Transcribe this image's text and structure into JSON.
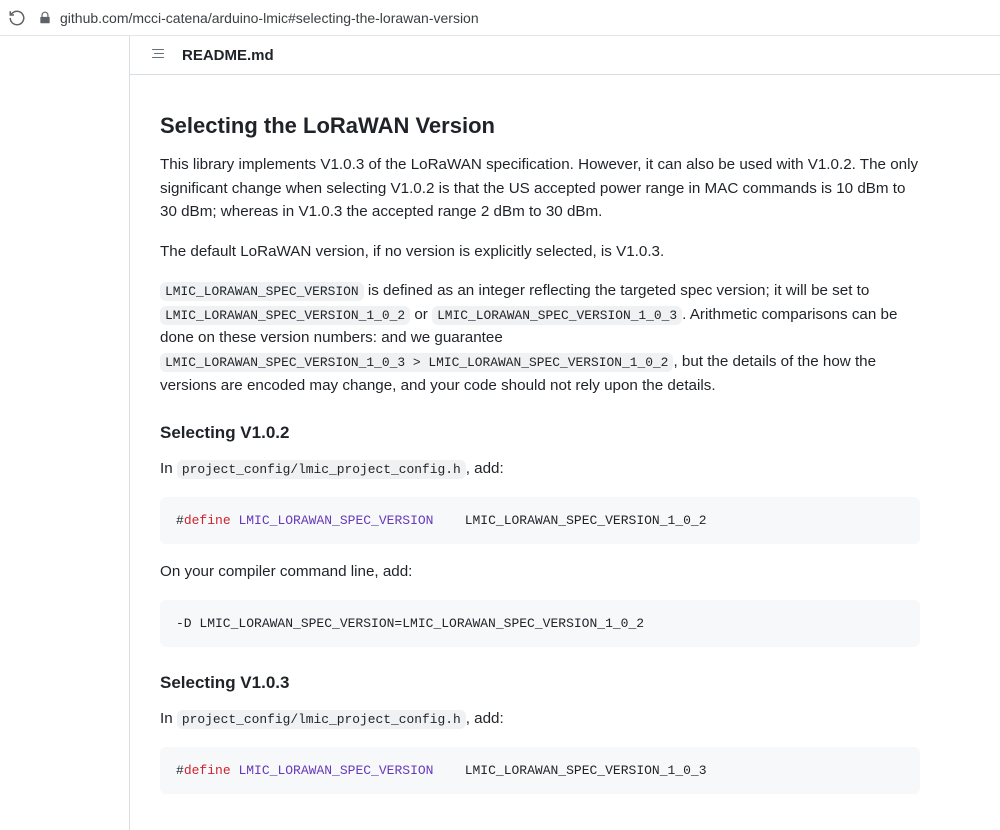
{
  "browser": {
    "url": "github.com/mcci-catena/arduino-lmic#selecting-the-lorawan-version"
  },
  "file": {
    "name": "README.md"
  },
  "doc": {
    "h2": "Selecting the LoRaWAN Version",
    "p1": "This library implements V1.0.3 of the LoRaWAN specification. However, it can also be used with V1.0.2. The only significant change when selecting V1.0.2 is that the US accepted power range in MAC commands is 10 dBm to 30 dBm; whereas in V1.0.3 the accepted range 2 dBm to 30 dBm.",
    "p2": "The default LoRaWAN version, if no version is explicitly selected, is V1.0.3.",
    "p3": {
      "c1": "LMIC_LORAWAN_SPEC_VERSION",
      "t1": " is defined as an integer reflecting the targeted spec version; it will be set to ",
      "c2": "LMIC_LORAWAN_SPEC_VERSION_1_0_2",
      "t2": " or ",
      "c3": "LMIC_LORAWAN_SPEC_VERSION_1_0_3",
      "t3": ". Arithmetic comparisons can be done on these version numbers: and we guarantee ",
      "c4": "LMIC_LORAWAN_SPEC_VERSION_1_0_3 > LMIC_LORAWAN_SPEC_VERSION_1_0_2",
      "t4": ", but the details of the how the versions are encoded may change, and your code should not rely upon the details."
    },
    "h3a": "Selecting V1.0.2",
    "p4": {
      "t1": "In ",
      "c1": "project_config/lmic_project_config.h",
      "t2": ", add:"
    },
    "code1": {
      "pre": "#",
      "kw": "define",
      "sp": " ",
      "const": "LMIC_LORAWAN_SPEC_VERSION",
      "rest": "    LMIC_LORAWAN_SPEC_VERSION_1_0_2"
    },
    "p5": "On your compiler command line, add:",
    "code2": "-D LMIC_LORAWAN_SPEC_VERSION=LMIC_LORAWAN_SPEC_VERSION_1_0_2",
    "h3b": "Selecting V1.0.3",
    "p6": {
      "t1": "In ",
      "c1": "project_config/lmic_project_config.h",
      "t2": ", add:"
    },
    "code3": {
      "pre": "#",
      "kw": "define",
      "sp": " ",
      "const": "LMIC_LORAWAN_SPEC_VERSION",
      "rest": "    LMIC_LORAWAN_SPEC_VERSION_1_0_3"
    }
  }
}
